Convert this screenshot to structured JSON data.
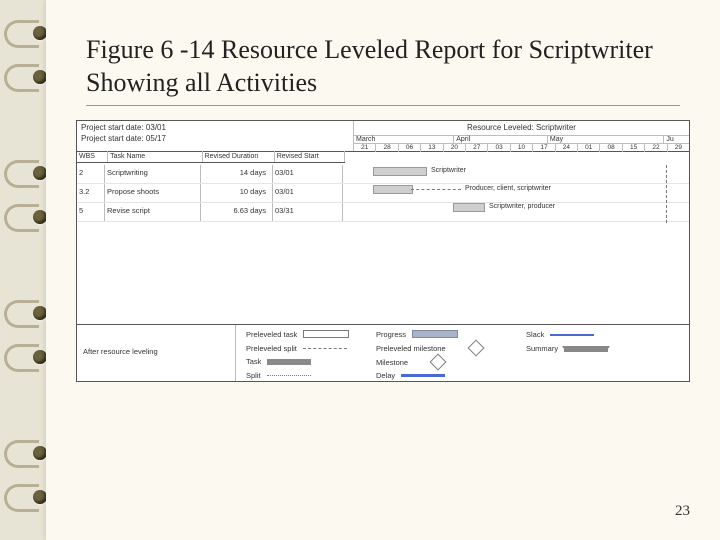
{
  "title": "Figure 6 -14 Resource Leveled Report for Scriptwriter Showing all Activities",
  "page_number": "23",
  "report": {
    "project_start": "Project start date: 03/01",
    "project_end": "Project start date: 05/17",
    "resource_title": "Resource Leveled: Scriptwriter",
    "after_note": "After resource leveling",
    "columns": {
      "wbs": "WBS",
      "task": "Task Name",
      "dur": "Revised Duration",
      "start": "Revised Start"
    },
    "months": [
      "March",
      "April",
      "May",
      "Ju"
    ],
    "days": [
      "21",
      "28",
      "06",
      "13",
      "20",
      "27",
      "03",
      "10",
      "17",
      "24",
      "01",
      "08",
      "15",
      "22",
      "29"
    ],
    "tasks": [
      {
        "wbs": "2",
        "name": "Scriptwriting",
        "dur": "14 days",
        "start": "03/01",
        "bar_label": "Scriptwriter"
      },
      {
        "wbs": "3.2",
        "name": "Propose shoots",
        "dur": "10 days",
        "start": "03/01",
        "bar_label": "Producer, client, scriptwriter"
      },
      {
        "wbs": "5",
        "name": "Revise script",
        "dur": "6.63 days",
        "start": "03/31",
        "bar_label": "Scriptwriter, producer"
      }
    ],
    "legend": {
      "preleveled_task": "Preleveled task",
      "preleveled_split": "Preleveled split",
      "task": "Task",
      "split": "Split",
      "progress": "Progress",
      "preleveled_milestone": "Preleveled milestone",
      "milestone": "Milestone",
      "delay": "Delay",
      "slack": "Slack",
      "summary": "Summary"
    }
  }
}
